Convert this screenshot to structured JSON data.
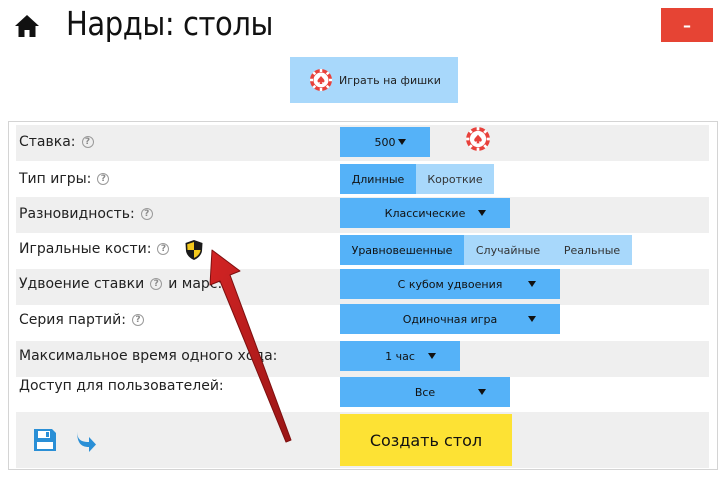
{
  "header": {
    "title": "Нарды: столы",
    "close_label": "–",
    "home_icon": "home-icon"
  },
  "chips_button": {
    "label": "Играть на фишки",
    "icon": "poker-chip-icon"
  },
  "form": {
    "stake": {
      "label": "Ставка:",
      "value": "500"
    },
    "game_type": {
      "label": "Тип игры:",
      "options": [
        "Длинные",
        "Короткие"
      ],
      "selected": "Длинные"
    },
    "variant": {
      "label": "Разновидность:",
      "value": "Классические"
    },
    "dice": {
      "label": "Игральные кости:",
      "options": [
        "Уравновешенные",
        "Случайные",
        "Реальные"
      ],
      "selected": "Уравновешенные"
    },
    "doubling": {
      "label_part1": "Удвоение ставки",
      "label_part2": "и марс:",
      "value": "С кубом удвоения"
    },
    "series": {
      "label": "Серия партий:",
      "value": "Одиночная игра"
    },
    "max_time": {
      "label": "Максимальное время одного хода:",
      "value": "1 час"
    },
    "access": {
      "label": "Доступ для пользователей:",
      "value": "Все"
    },
    "create_label": "Создать стол"
  },
  "colors": {
    "accent_blue": "#55b2f8",
    "light_blue": "#a8d8fb",
    "create_yellow": "#fde234",
    "close_red": "#e64434",
    "annotation_arrow": "#b81c1c"
  }
}
